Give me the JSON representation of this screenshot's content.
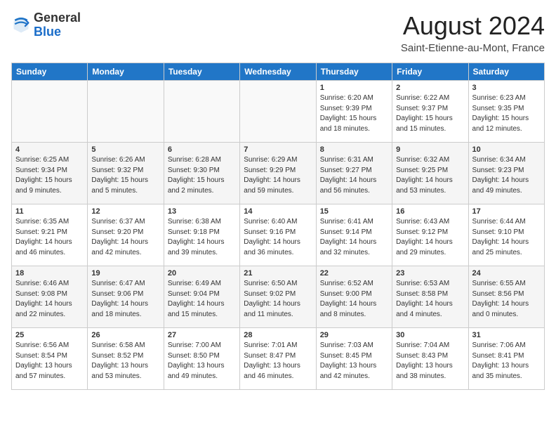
{
  "header": {
    "logo_general": "General",
    "logo_blue": "Blue",
    "month_title": "August 2024",
    "location": "Saint-Etienne-au-Mont, France"
  },
  "days_of_week": [
    "Sunday",
    "Monday",
    "Tuesday",
    "Wednesday",
    "Thursday",
    "Friday",
    "Saturday"
  ],
  "weeks": [
    [
      {
        "day": "",
        "data": ""
      },
      {
        "day": "",
        "data": ""
      },
      {
        "day": "",
        "data": ""
      },
      {
        "day": "",
        "data": ""
      },
      {
        "day": "1",
        "data": "Sunrise: 6:20 AM\nSunset: 9:39 PM\nDaylight: 15 hours\nand 18 minutes."
      },
      {
        "day": "2",
        "data": "Sunrise: 6:22 AM\nSunset: 9:37 PM\nDaylight: 15 hours\nand 15 minutes."
      },
      {
        "day": "3",
        "data": "Sunrise: 6:23 AM\nSunset: 9:35 PM\nDaylight: 15 hours\nand 12 minutes."
      }
    ],
    [
      {
        "day": "4",
        "data": "Sunrise: 6:25 AM\nSunset: 9:34 PM\nDaylight: 15 hours\nand 9 minutes."
      },
      {
        "day": "5",
        "data": "Sunrise: 6:26 AM\nSunset: 9:32 PM\nDaylight: 15 hours\nand 5 minutes."
      },
      {
        "day": "6",
        "data": "Sunrise: 6:28 AM\nSunset: 9:30 PM\nDaylight: 15 hours\nand 2 minutes."
      },
      {
        "day": "7",
        "data": "Sunrise: 6:29 AM\nSunset: 9:29 PM\nDaylight: 14 hours\nand 59 minutes."
      },
      {
        "day": "8",
        "data": "Sunrise: 6:31 AM\nSunset: 9:27 PM\nDaylight: 14 hours\nand 56 minutes."
      },
      {
        "day": "9",
        "data": "Sunrise: 6:32 AM\nSunset: 9:25 PM\nDaylight: 14 hours\nand 53 minutes."
      },
      {
        "day": "10",
        "data": "Sunrise: 6:34 AM\nSunset: 9:23 PM\nDaylight: 14 hours\nand 49 minutes."
      }
    ],
    [
      {
        "day": "11",
        "data": "Sunrise: 6:35 AM\nSunset: 9:21 PM\nDaylight: 14 hours\nand 46 minutes."
      },
      {
        "day": "12",
        "data": "Sunrise: 6:37 AM\nSunset: 9:20 PM\nDaylight: 14 hours\nand 42 minutes."
      },
      {
        "day": "13",
        "data": "Sunrise: 6:38 AM\nSunset: 9:18 PM\nDaylight: 14 hours\nand 39 minutes."
      },
      {
        "day": "14",
        "data": "Sunrise: 6:40 AM\nSunset: 9:16 PM\nDaylight: 14 hours\nand 36 minutes."
      },
      {
        "day": "15",
        "data": "Sunrise: 6:41 AM\nSunset: 9:14 PM\nDaylight: 14 hours\nand 32 minutes."
      },
      {
        "day": "16",
        "data": "Sunrise: 6:43 AM\nSunset: 9:12 PM\nDaylight: 14 hours\nand 29 minutes."
      },
      {
        "day": "17",
        "data": "Sunrise: 6:44 AM\nSunset: 9:10 PM\nDaylight: 14 hours\nand 25 minutes."
      }
    ],
    [
      {
        "day": "18",
        "data": "Sunrise: 6:46 AM\nSunset: 9:08 PM\nDaylight: 14 hours\nand 22 minutes."
      },
      {
        "day": "19",
        "data": "Sunrise: 6:47 AM\nSunset: 9:06 PM\nDaylight: 14 hours\nand 18 minutes."
      },
      {
        "day": "20",
        "data": "Sunrise: 6:49 AM\nSunset: 9:04 PM\nDaylight: 14 hours\nand 15 minutes."
      },
      {
        "day": "21",
        "data": "Sunrise: 6:50 AM\nSunset: 9:02 PM\nDaylight: 14 hours\nand 11 minutes."
      },
      {
        "day": "22",
        "data": "Sunrise: 6:52 AM\nSunset: 9:00 PM\nDaylight: 14 hours\nand 8 minutes."
      },
      {
        "day": "23",
        "data": "Sunrise: 6:53 AM\nSunset: 8:58 PM\nDaylight: 14 hours\nand 4 minutes."
      },
      {
        "day": "24",
        "data": "Sunrise: 6:55 AM\nSunset: 8:56 PM\nDaylight: 14 hours\nand 0 minutes."
      }
    ],
    [
      {
        "day": "25",
        "data": "Sunrise: 6:56 AM\nSunset: 8:54 PM\nDaylight: 13 hours\nand 57 minutes."
      },
      {
        "day": "26",
        "data": "Sunrise: 6:58 AM\nSunset: 8:52 PM\nDaylight: 13 hours\nand 53 minutes."
      },
      {
        "day": "27",
        "data": "Sunrise: 7:00 AM\nSunset: 8:50 PM\nDaylight: 13 hours\nand 49 minutes."
      },
      {
        "day": "28",
        "data": "Sunrise: 7:01 AM\nSunset: 8:47 PM\nDaylight: 13 hours\nand 46 minutes."
      },
      {
        "day": "29",
        "data": "Sunrise: 7:03 AM\nSunset: 8:45 PM\nDaylight: 13 hours\nand 42 minutes."
      },
      {
        "day": "30",
        "data": "Sunrise: 7:04 AM\nSunset: 8:43 PM\nDaylight: 13 hours\nand 38 minutes."
      },
      {
        "day": "31",
        "data": "Sunrise: 7:06 AM\nSunset: 8:41 PM\nDaylight: 13 hours\nand 35 minutes."
      }
    ]
  ]
}
